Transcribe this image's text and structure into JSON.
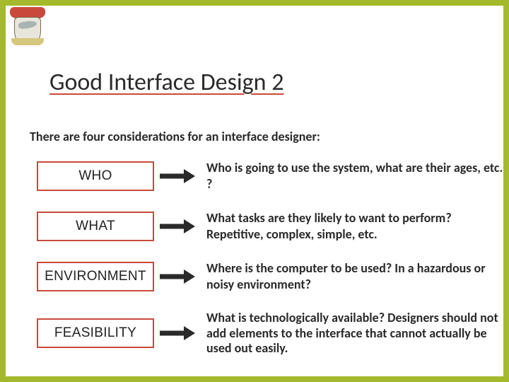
{
  "title": "Good Interface Design 2",
  "intro": "There are four considerations for an interface designer:",
  "rows": [
    {
      "label": "WHO",
      "desc": "Who is going to use the system, what are their ages, etc. ?"
    },
    {
      "label": "WHAT",
      "desc": "What tasks are they likely to want to perform? Repetitive, complex, simple, etc."
    },
    {
      "label": "ENVIRONMENT",
      "desc": "Where is the computer to be used? In a hazardous or noisy environment?"
    },
    {
      "label": "FEASIBILITY",
      "desc": "What is technologically available? Designers should not add elements to the interface that cannot actually be used out easily."
    }
  ]
}
